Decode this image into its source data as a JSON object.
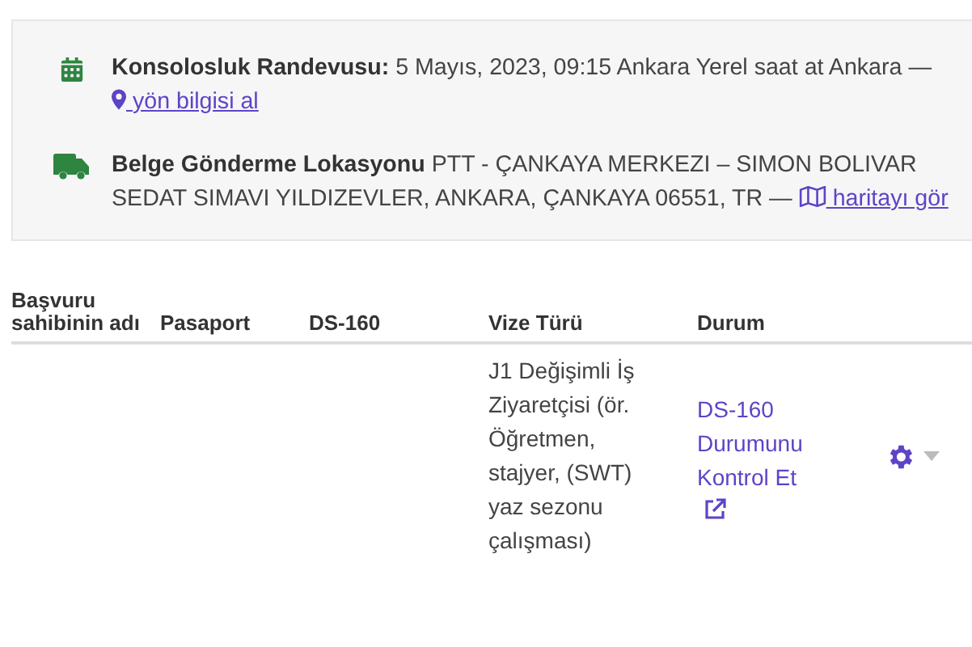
{
  "info_panel": {
    "items": [
      {
        "kind": "appointment",
        "label": "Konsolosluk Randevusu:",
        "text": "5 Mayıs, 2023, 09:15 Ankara Yerel saat at Ankara —",
        "link": " yön bilgisi al"
      },
      {
        "kind": "delivery",
        "label": "Belge Gönderme Lokasyonu",
        "text": "PTT - ÇANKAYA MERKEZI – SIMON BOLIVAR SEDAT SIMAVI YILDIZEVLER, ANKARA, ÇANKAYA 06551, TR —",
        "link": " haritayı gör"
      }
    ]
  },
  "table": {
    "columns": [
      "Başvuru sahibinin adı",
      "Pasaport",
      "DS-160",
      "Vize Türü",
      "Durum"
    ],
    "rows": [
      {
        "visa_type": "J1 Değişimli İş Ziyaretçisi (ör. Öğretmen, stajyer, (SWT) yaz sezonu çalışması)",
        "status_link": "DS-160 Durumunu Kontrol Et"
      }
    ]
  }
}
